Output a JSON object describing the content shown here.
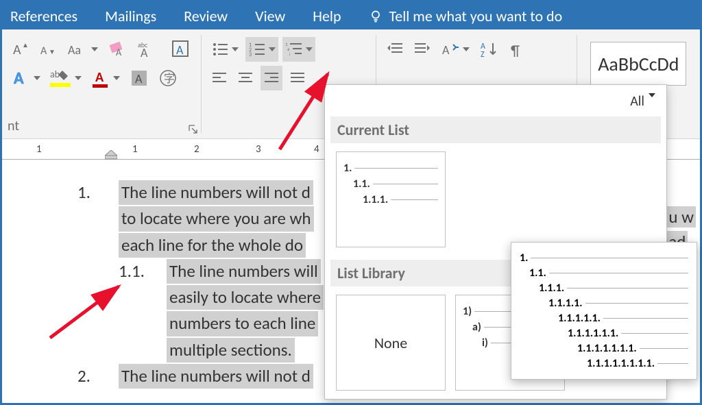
{
  "tabs": [
    "References",
    "Mailings",
    "Review",
    "View",
    "Help"
  ],
  "tellme": "Tell me what you want to do",
  "fontGroup": {
    "name": "nt"
  },
  "styleSample": "AaBbCcDd",
  "ruler": {
    "labels": [
      "1",
      "1",
      "2",
      "3",
      "4"
    ]
  },
  "doc": {
    "items": [
      {
        "num": "1.",
        "text": "The line numbers will not d",
        "more1": "to locate where you are wh",
        "more2": "each line for the whole do"
      },
      {
        "num": "1.1.",
        "text": "The line numbers will",
        "more1": "easily to locate where",
        "more2": "numbers to each line",
        "more3": "multiple sections."
      },
      {
        "num": "2.",
        "text": "The line numbers will not d"
      }
    ],
    "cutright": [
      "u w",
      "ad"
    ]
  },
  "dropdown": {
    "allLabel": "All",
    "sectionCurrent": "Current List",
    "sectionLibrary": "List Library",
    "currentLevels": [
      "1.",
      "1.1.",
      "1.1.1."
    ],
    "noneLabel": "None",
    "lib2Levels": [
      "1)",
      "a)",
      "i)"
    ],
    "previewLevels": [
      "1.",
      "1.1.",
      "1.1.1.",
      "1.1.1.1.",
      "1.1.1.1.1.",
      "1.1.1.1.1.1.",
      "1.1.1.1.1.1.1.",
      "1.1.1.1.1.1.1.1."
    ]
  }
}
